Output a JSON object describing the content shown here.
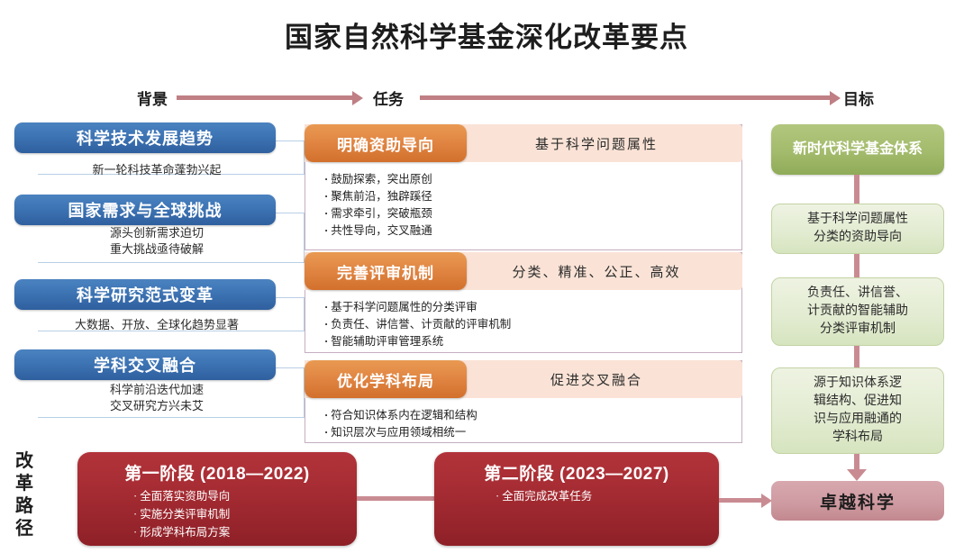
{
  "title": "国家自然科学基金深化改革要点",
  "header": {
    "background_label": "背景",
    "task_label": "任务",
    "goal_label": "目标"
  },
  "colors": {
    "blue": "#3d74b4",
    "orange": "#e08442",
    "pink_strip": "#fae3d6",
    "green_dark": "#a3bb6c",
    "green_light": "#e3ecd2",
    "rose": "#c98b92",
    "dark_red": "#a62c33"
  },
  "background_column": [
    {
      "heading": "科学技术发展趋势",
      "details": [
        "新一轮科技革命蓬勃兴起"
      ]
    },
    {
      "heading": "国家需求与全球挑战",
      "details": [
        "源头创新需求迫切",
        "重大挑战亟待破解"
      ]
    },
    {
      "heading": "科学研究范式变革",
      "details": [
        "大数据、开放、全球化趋势显著"
      ]
    },
    {
      "heading": "学科交叉融合",
      "details": [
        "科学前沿迭代加速",
        "交叉研究方兴未艾"
      ]
    }
  ],
  "task_column": [
    {
      "heading": "明确资助导向",
      "banner": "基于科学问题属性",
      "bullets": [
        "鼓励探索，突出原创",
        "聚焦前沿，独辟蹊径",
        "需求牵引，突破瓶颈",
        "共性导向，交叉融通"
      ]
    },
    {
      "heading": "完善评审机制",
      "banner": "分类、精准、公正、高效",
      "bullets": [
        "基于科学问题属性的分类评审",
        "负责任、讲信誉、计贡献的评审机制",
        "智能辅助评审管理系统"
      ]
    },
    {
      "heading": "优化学科布局",
      "banner": "促进交叉融合",
      "bullets": [
        "符合知识体系内在逻辑和结构",
        "知识层次与应用领域相统一"
      ]
    }
  ],
  "goal_column": {
    "head": "新时代科学\n基金体系",
    "head_lines": [
      "新时代科学",
      "基金体系"
    ],
    "items": [
      {
        "lines": [
          "基于科学问题属性",
          "分类的资助导向"
        ]
      },
      {
        "lines": [
          "负责任、讲信誉、",
          "计贡献的智能辅助",
          "分类评审机制"
        ]
      },
      {
        "lines": [
          "源于知识体系逻",
          "辑结构、促进知",
          "识与应用融通的",
          "学科布局"
        ]
      }
    ],
    "final": "卓越科学"
  },
  "reform_path": {
    "label": "改革路径",
    "label_chars": [
      "改",
      "革",
      "路",
      "径"
    ],
    "stages": [
      {
        "title": "第一阶段 (2018—2022)",
        "bullets": [
          "全面落实资助导向",
          "实施分类评审机制",
          "形成学科布局方案"
        ]
      },
      {
        "title": "第二阶段 (2023—2027)",
        "bullets": [
          "全面完成改革任务"
        ]
      }
    ]
  }
}
